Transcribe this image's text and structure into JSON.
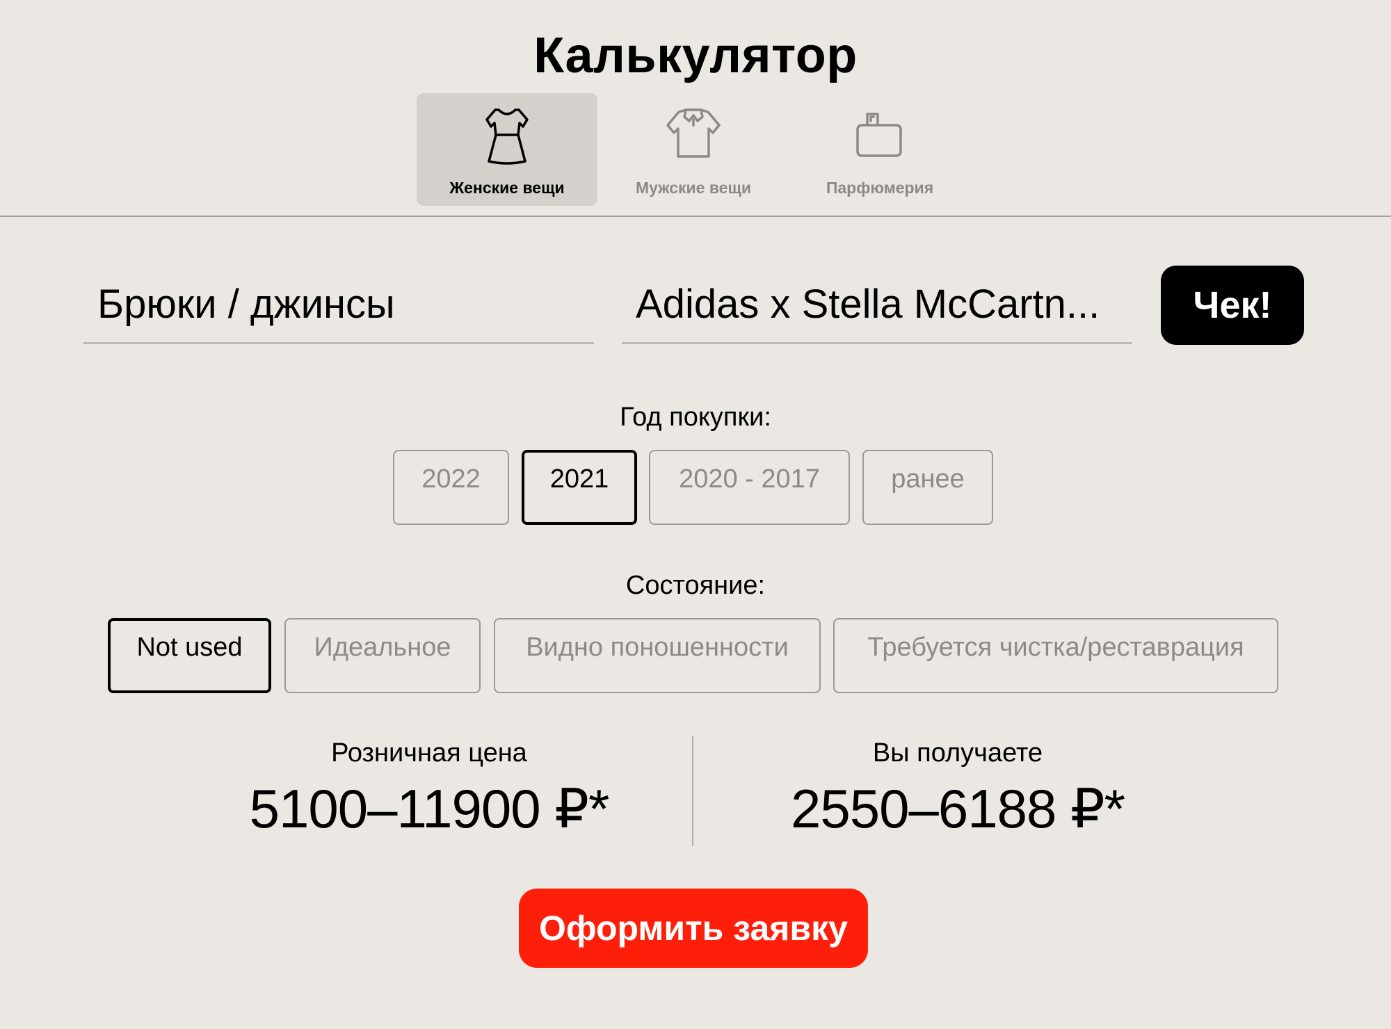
{
  "header": {
    "title": "Калькулятор",
    "tabs": [
      {
        "label": "Женские вещи",
        "icon": "dress-icon",
        "active": true
      },
      {
        "label": "Мужские вещи",
        "icon": "polo-shirt-icon",
        "active": false
      },
      {
        "label": "Парфюмерия",
        "icon": "perfume-bottle-icon",
        "active": false
      }
    ]
  },
  "form": {
    "category_value": "Брюки / джинсы",
    "brand_value": "Adidas x Stella McCartn...",
    "check_button_label": "Чек!"
  },
  "purchase_year": {
    "label": "Год покупки:",
    "options": [
      "2022",
      "2021",
      "2020 - 2017",
      "ранее"
    ],
    "selected": "2021"
  },
  "condition": {
    "label": "Состояние:",
    "options": [
      "Not used",
      "Идеальное",
      "Видно поношенности",
      "Требуется чистка/реставрация"
    ],
    "selected": "Not used"
  },
  "result": {
    "retail_label": "Розничная цена",
    "retail_value": "5100–11900 ₽*",
    "payout_label": "Вы получаете",
    "payout_value": "2550–6188 ₽*"
  },
  "submit_label": "Оформить заявку",
  "colors": {
    "background": "#ebe8e3",
    "accent": "#fe1f0a",
    "active_tab": "#d4d1cd",
    "muted_text": "#8c8a86"
  }
}
